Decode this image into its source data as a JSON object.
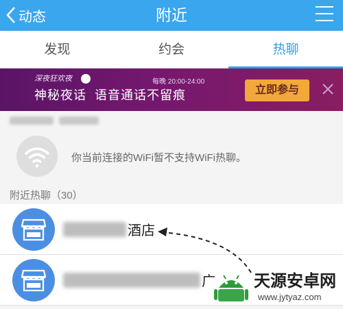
{
  "header": {
    "back_label": "动态",
    "title": "附近"
  },
  "tabs": [
    {
      "label": "发现",
      "active": false
    },
    {
      "label": "约会",
      "active": false
    },
    {
      "label": "热聊",
      "active": true
    }
  ],
  "banner": {
    "logo_text": "深夜狂欢夜",
    "headline_a": "神秘夜话",
    "headline_b": "语音通话不留痕",
    "time": "每晚 20:00-24:00",
    "join_label": "立即参与"
  },
  "wifi_notice": {
    "text": "你当前连接的WiFi暂不支持WiFi热聊。"
  },
  "nearby": {
    "section_label": "附近热聊（30）",
    "items": [
      {
        "visible_name": "酒店"
      },
      {
        "visible_name": "广"
      }
    ]
  },
  "watermark": {
    "title": "天源安卓网",
    "url": "www.jytyaz.com"
  },
  "colors": {
    "header": "#3aa6ee",
    "tab_active": "#2ea1e8",
    "banner": "#74186f",
    "join_button": "#f2a83a",
    "shop_icon": "#4c8fe2"
  }
}
